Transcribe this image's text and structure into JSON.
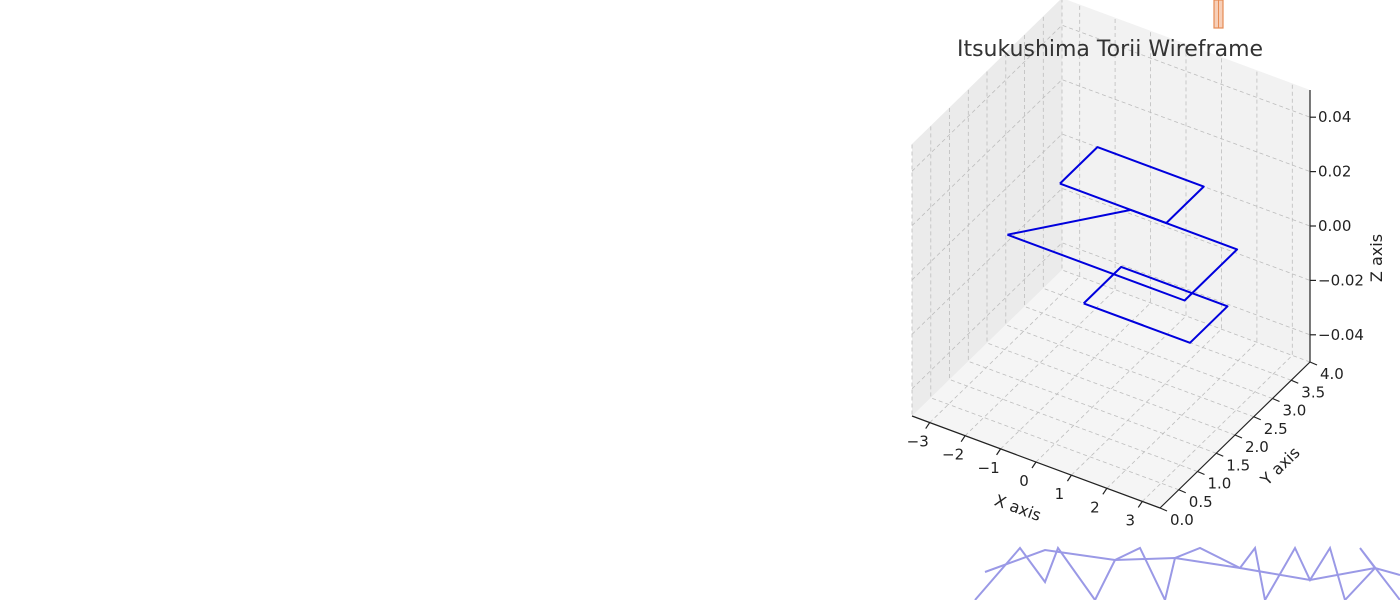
{
  "chart_data": {
    "type": "line",
    "projection": "3d",
    "title": "Itsukushima Torii Wireframe",
    "xlabel": "X axis",
    "ylabel": "Y axis",
    "zlabel": "Z axis",
    "xlim": [
      -3.5,
      3.5
    ],
    "ylim": [
      0,
      4
    ],
    "zlim": [
      -0.05,
      0.05
    ],
    "grid": true,
    "x_ticks": [
      -3,
      -2,
      -1,
      0,
      1,
      2,
      3
    ],
    "y_ticks": [
      0.0,
      0.5,
      1.0,
      1.5,
      2.0,
      2.5,
      3.0,
      3.5,
      4.0
    ],
    "z_ticks": [
      -0.04,
      -0.02,
      0.0,
      0.02,
      0.04
    ],
    "x_tick_labels": [
      "−3",
      "−2",
      "−1",
      "0",
      "1",
      "2",
      "3"
    ],
    "y_tick_labels": [
      "0.0",
      "0.5",
      "1.0",
      "1.5",
      "2.0",
      "2.5",
      "3.0",
      "3.5",
      "4.0"
    ],
    "z_tick_labels": [
      "−0.04",
      "−0.02",
      "0.00",
      "0.02",
      "0.04"
    ],
    "series": [
      {
        "color": "#0000dd",
        "x": [
          -2.5,
          2.5,
          2.5,
          0.5,
          -0.5,
          -2.5
        ],
        "y": [
          1.6,
          1.6,
          3.0,
          3.0,
          3.0,
          1.6
        ],
        "z": [
          0.0,
          0.0,
          0.0,
          0.0,
          0.0,
          0.0
        ]
      },
      {
        "color": "#0000dd",
        "x": [
          -2.5,
          0.5,
          0.5,
          -2.5,
          -2.5
        ],
        "y": [
          3.0,
          3.0,
          4.0,
          4.0,
          3.0
        ],
        "z": [
          0.0,
          0.0,
          0.0,
          0.0,
          0.0
        ]
      },
      {
        "color": "#0000dd",
        "x": [
          0.5,
          3.5,
          3.5,
          0.5,
          0.5
        ],
        "y": [
          0.8,
          0.8,
          1.8,
          1.8,
          0.8
        ],
        "z": [
          0.0,
          0.0,
          0.0,
          0.0,
          0.0
        ]
      }
    ]
  }
}
